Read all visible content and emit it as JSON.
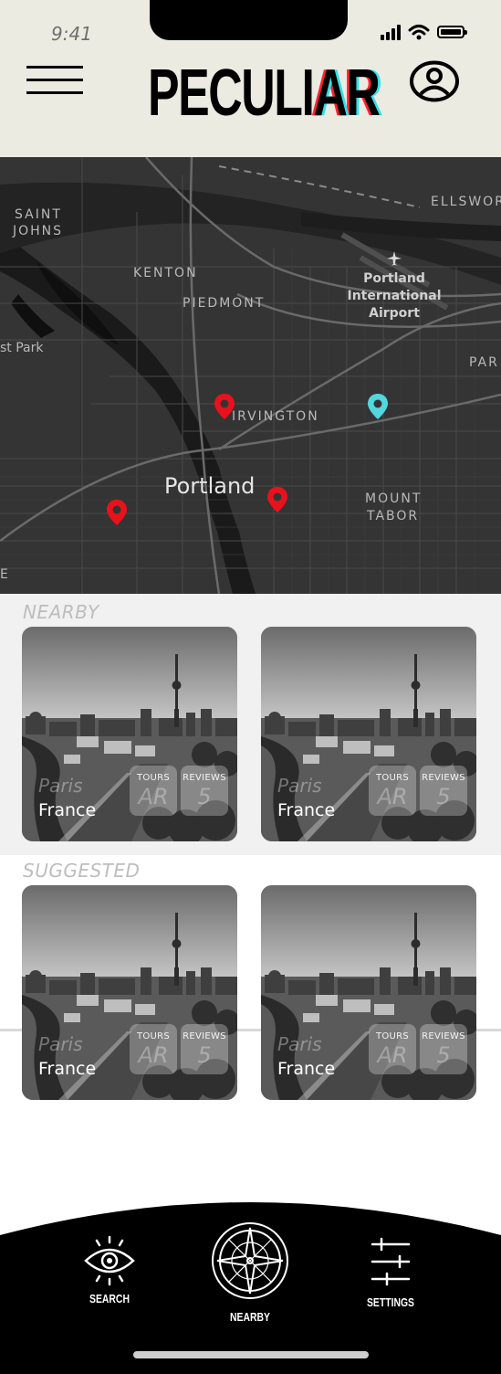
{
  "status_bar": {
    "time": "9:41"
  },
  "header": {
    "logo_text": "PECULI",
    "logo_accent": "AR"
  },
  "map": {
    "labels": {
      "saint_johns_1": "SAINT",
      "saint_johns_2": "JOHNS",
      "kenton": "KENTON",
      "piedmont": "PIEDMONT",
      "ellsworth": "ELLSWOR",
      "airport_1": "Portland",
      "airport_2": "International",
      "airport_3": "Airport",
      "park": "st Park",
      "parkrose": "PAR",
      "irvington": "IRVINGTON",
      "city": "Portland",
      "mount_1": "MOUNT",
      "mount_2": "TABOR",
      "edge": "E"
    },
    "pin_colors": {
      "red": "#e8121c",
      "cyan": "#53d6dd"
    }
  },
  "sections": {
    "nearby": {
      "title": "NEARBY",
      "cards": [
        {
          "city": "Paris",
          "country": "France",
          "tours_label": "TOURS",
          "tours_value": "AR",
          "reviews_label": "REVIEWS",
          "reviews_value": "5"
        },
        {
          "city": "Paris",
          "country": "France",
          "tours_label": "TOURS",
          "tours_value": "AR",
          "reviews_label": "REVIEWS",
          "reviews_value": "5"
        }
      ]
    },
    "suggested": {
      "title": "SUGGESTED",
      "cards": [
        {
          "city": "Paris",
          "country": "France",
          "tours_label": "TOURS",
          "tours_value": "AR",
          "reviews_label": "REVIEWS",
          "reviews_value": "5"
        },
        {
          "city": "Paris",
          "country": "France",
          "tours_label": "TOURS",
          "tours_value": "AR",
          "reviews_label": "REVIEWS",
          "reviews_value": "5"
        }
      ]
    }
  },
  "nav": {
    "search": "SEARCH",
    "nearby": "NEARBY",
    "settings": "SETTINGS"
  }
}
